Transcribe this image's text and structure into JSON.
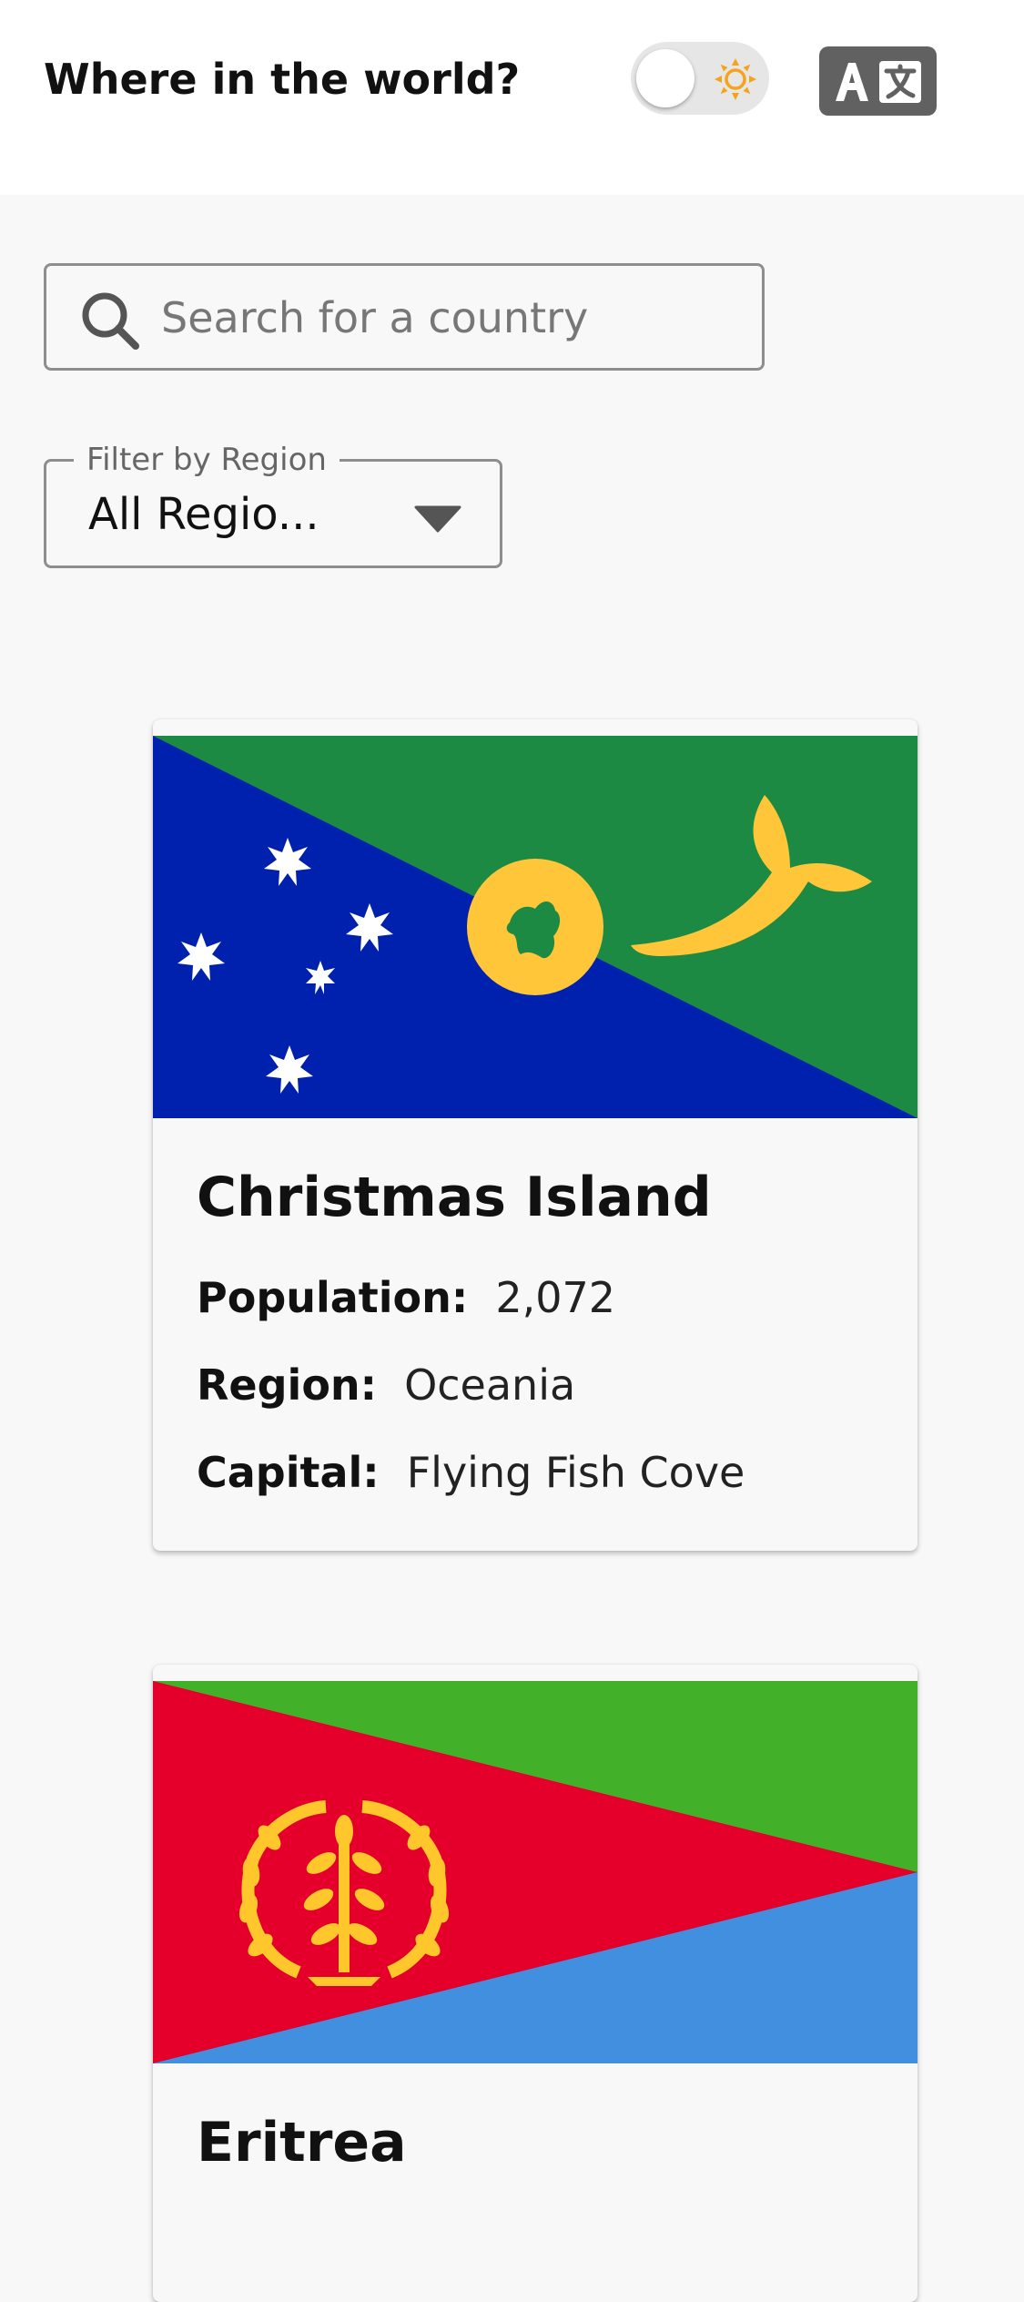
{
  "header": {
    "title": "Where in the world?"
  },
  "search": {
    "placeholder": "Search for a country",
    "value": ""
  },
  "filter": {
    "label": "Filter by Region",
    "selected": "All Regio..."
  },
  "labels": {
    "population": "Population:",
    "region": "Region:",
    "capital": "Capital:"
  },
  "countries": [
    {
      "name": "Christmas Island",
      "population": "2,072",
      "region": "Oceania",
      "capital": "Flying Fish Cove",
      "flag_icon": "christmas-island-flag"
    },
    {
      "name": "Eritrea",
      "flag_icon": "eritrea-flag"
    }
  ],
  "colors": {
    "accent_sun": "#f5a31a",
    "translate_bg": "#616161",
    "page_bg": "#f8f8f8",
    "header_bg": "#ffffff"
  }
}
